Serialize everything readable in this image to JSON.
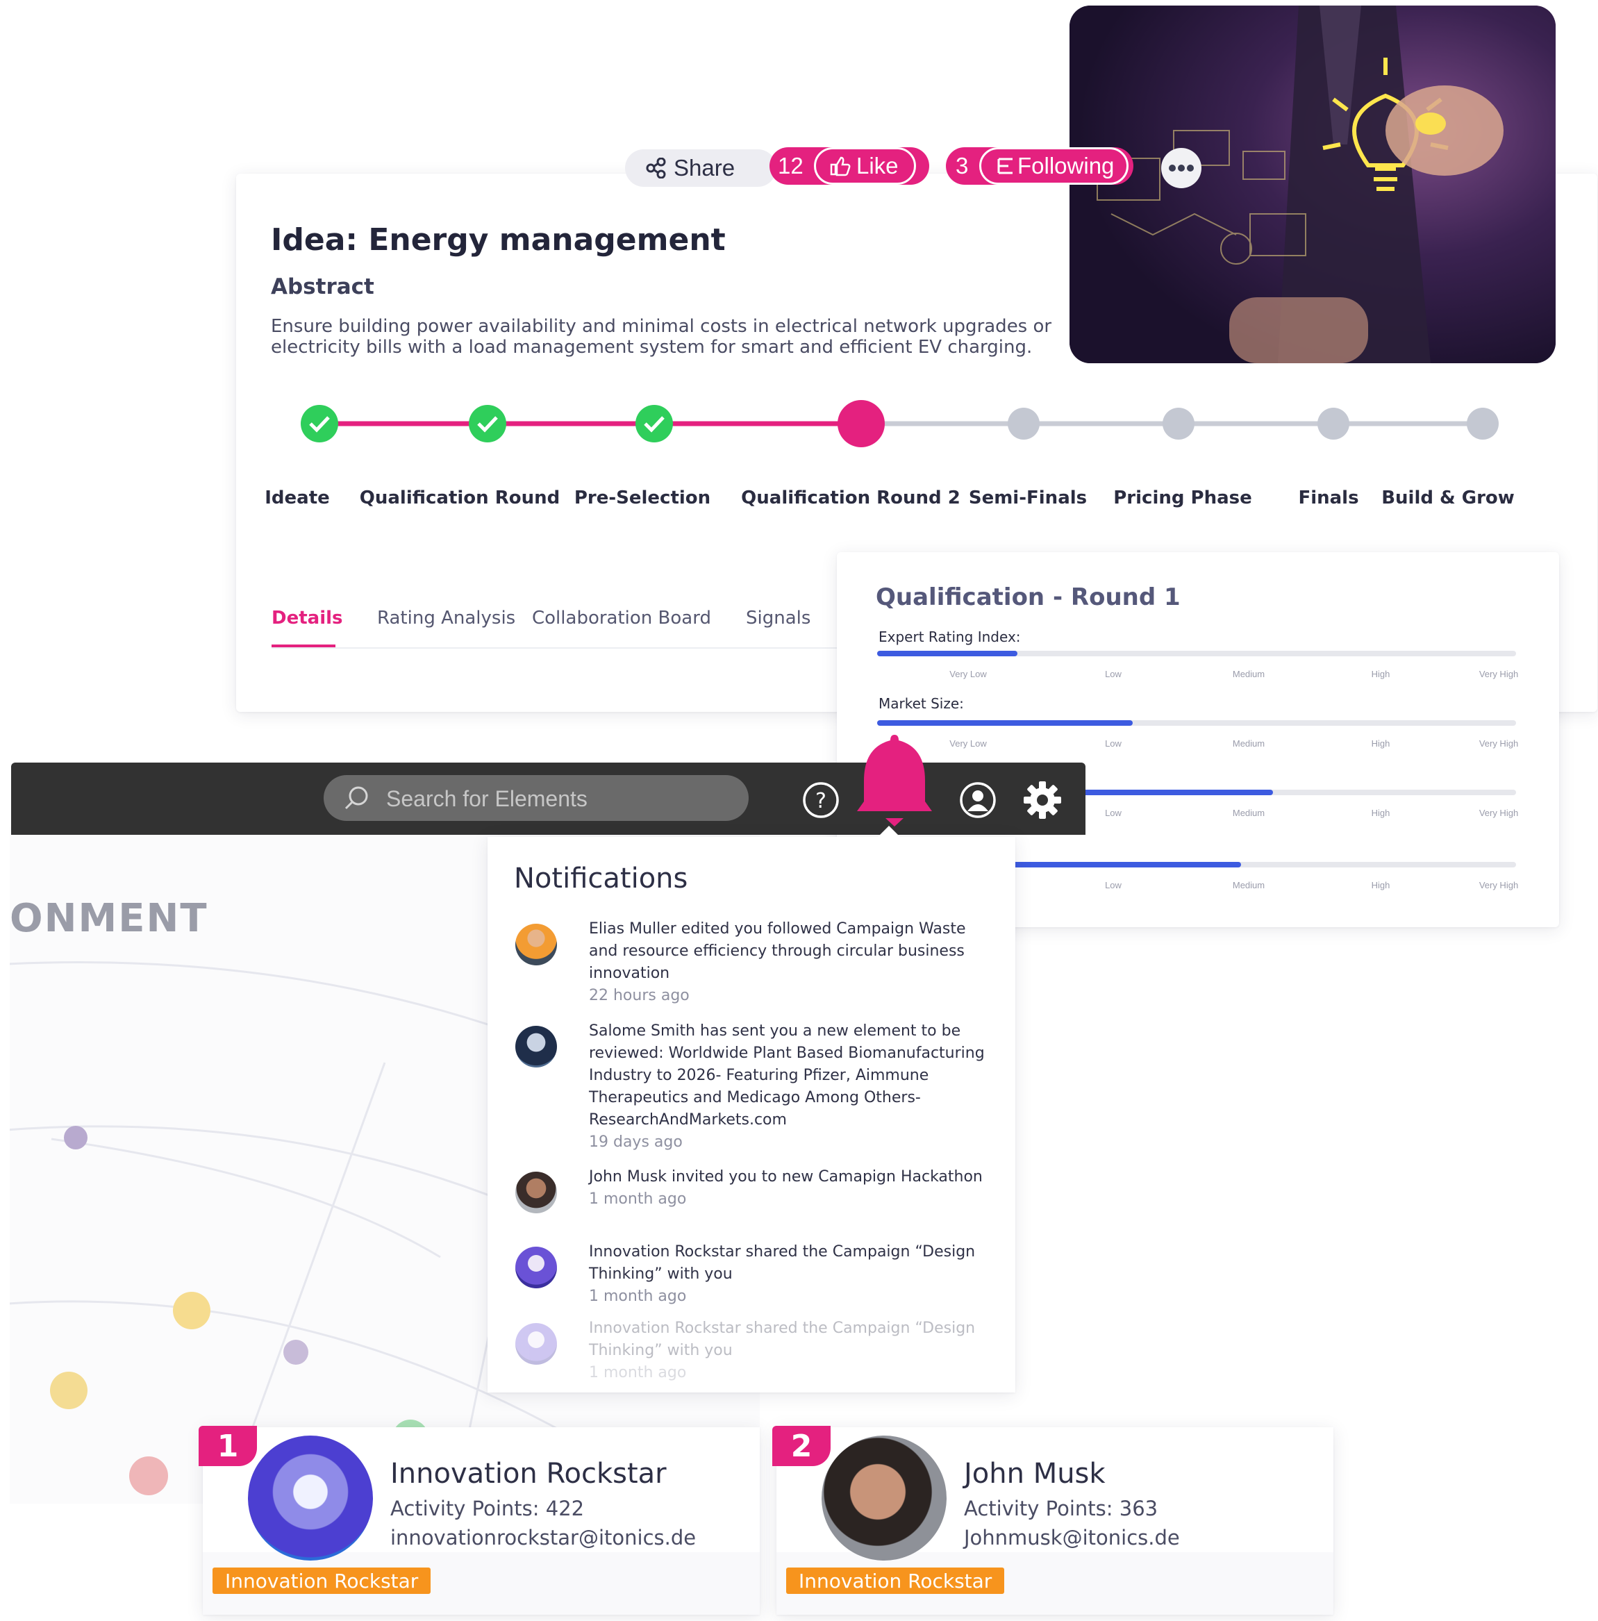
{
  "idea": {
    "title": "Idea: Energy management",
    "abstract_heading": "Abstract",
    "abstract_text": "Ensure building power availability and minimal costs in electrical network upgrades or electricity bills with a load management system for smart and efficient EV charging."
  },
  "actions": {
    "share_label": "Share",
    "like_count": "12",
    "like_label": "Like",
    "following_count": "3",
    "following_label": "Following",
    "more_icon": "more-horizontal-icon"
  },
  "phases": [
    {
      "label": "Ideate",
      "status": "done"
    },
    {
      "label": "Qualification Round",
      "status": "done"
    },
    {
      "label": "Pre-Selection",
      "status": "done"
    },
    {
      "label": "Qualification Round 2",
      "status": "current"
    },
    {
      "label": "Semi-Finals",
      "status": "upcoming"
    },
    {
      "label": "Pricing Phase",
      "status": "upcoming"
    },
    {
      "label": "Finals",
      "status": "upcoming"
    },
    {
      "label": "Build & Grow",
      "status": "upcoming"
    }
  ],
  "tabs": [
    {
      "label": "Details",
      "active": true
    },
    {
      "label": "Rating Analysis",
      "active": false
    },
    {
      "label": "Collaboration Board",
      "active": false
    },
    {
      "label": "Signals",
      "active": false
    }
  ],
  "qualification": {
    "title": "Qualification - Round 1",
    "scale": [
      "Very Low",
      "Low",
      "Medium",
      "High",
      "Very High"
    ],
    "metrics": [
      {
        "label": "Expert Rating Index:",
        "value": 0.22
      },
      {
        "label": "Market Size:",
        "value": 0.4
      },
      {
        "label": "",
        "value": 0.62
      },
      {
        "label": "",
        "value": 0.57
      }
    ]
  },
  "toolbar": {
    "search_placeholder": "Search for Elements",
    "help_icon": "help-circle-icon",
    "bell_icon": "bell-icon",
    "user_icon": "user-circle-icon",
    "settings_icon": "gear-icon"
  },
  "background": {
    "section_title": "ONMENT"
  },
  "notifications": {
    "title": "Notifications",
    "items": [
      {
        "text": "Elias Muller edited you followed Campaign Waste and resource efficiency through circular business innovation",
        "time": "22 hours ago"
      },
      {
        "text": "Salome Smith has sent you a new element to be reviewed: Worldwide Plant Based Biomanufacturing Industry to 2026- Featuring Pfizer, Aimmune Therapeutics and Medicago Among Others- ResearchAndMarkets.com",
        "time": "19 days ago"
      },
      {
        "text": "John Musk invited you to new Camapign Hackathon",
        "time": "1 month ago"
      },
      {
        "text": "Innovation Rockstar shared the Campaign “Design Thinking” with you",
        "time": "1 month ago"
      },
      {
        "text": "Innovation Rockstar shared the Campaign “Design Thinking” with you",
        "time": "1 month ago"
      }
    ]
  },
  "leaderboard": [
    {
      "rank": "1",
      "name": "Innovation Rockstar",
      "points": "Activity Points: 422",
      "email": "innovationrockstar@itonics.de",
      "role": "Innovation Rockstar"
    },
    {
      "rank": "2",
      "name": "John Musk",
      "points": "Activity Points: 363",
      "email": "Johnmusk@itonics.de",
      "role": "Innovation Rockstar"
    }
  ],
  "colors": {
    "accent": "#e4217f",
    "done": "#2fce5b",
    "upcoming": "#c4c8d2",
    "bar": "#3d5be0",
    "toolbar": "#323232",
    "role": "#f7941d"
  }
}
